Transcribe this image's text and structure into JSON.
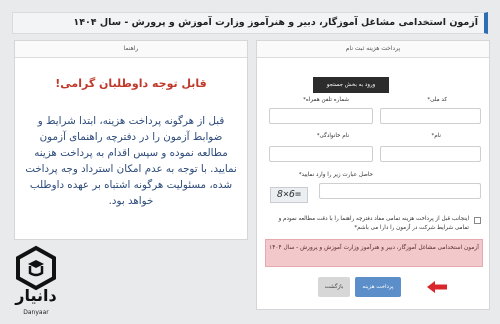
{
  "header": {
    "title": "آزمون استخدامی مشاغل آموزگار، دبیر و هنرآموز وزارت آموزش و پرورش - سال ۱۴۰۴"
  },
  "guide": {
    "heading": "راهنما",
    "notice_title": "قابل توجه داوطلبان گرامی!",
    "notice_body": "قبل از هرگونه پرداخت هزینه، ابتدا شرایط و ضوابط آزمون را در دفترچه راهنمای آزمون مطالعه نموده و سپس اقدام به پرداخت هزینه نمایید. با توجه به عدم امکان استرداد وجه پرداخت شده، مسئولیت هرگونه اشتباه بر عهده داوطلب خواهد بود."
  },
  "form": {
    "heading": "پرداخت هزینه ثبت نام",
    "search_button": "ورود به بخش جستجو",
    "national_id_label": "کد ملی*",
    "phone_label": "شماره تلفن همراه*",
    "first_name_label": "نام*",
    "last_name_label": "نام خانوادگی*",
    "captcha_label": "حاصل عبارت زیر را وارد نمایید*",
    "captcha_text": "8×6=",
    "consent_text": "اینجانب قبل از پرداخت هزینه تمامی مفاد دفترچه راهنما را با دقت مطالعه نمودم و تمامی شرایط شرکت در آزمون را دارا می باشم*",
    "exam_alert": "آزمون استخدامی مشاغل آموزگار، دبیر و هنرآموز وزارت آموزش و پرورش - سال ۱۴۰۴",
    "pay_button": "پرداخت هزینه",
    "back_button": "بازگشت"
  },
  "logo": {
    "name": "دانیار",
    "sub": "Danyaar"
  },
  "colors": {
    "accent": "#2e6db4",
    "alert_bg": "#f2c8cb",
    "pay_button": "#5c8fc9",
    "arrow": "#d9262c"
  }
}
